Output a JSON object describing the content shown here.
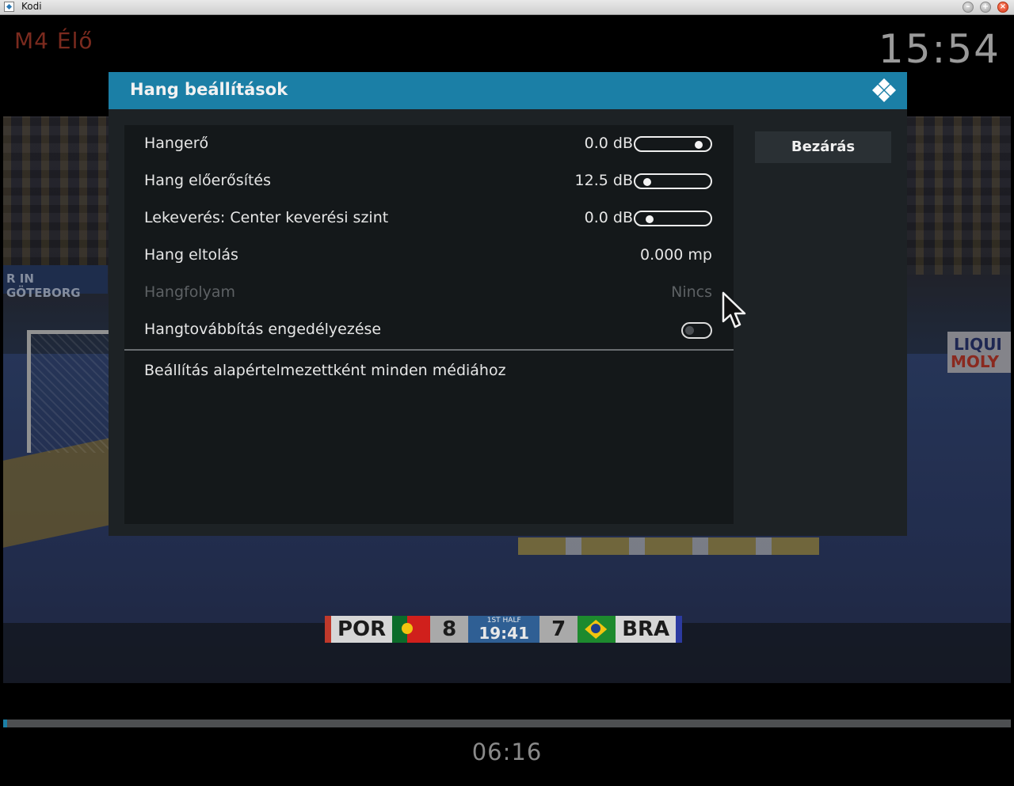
{
  "window": {
    "title": "Kodi",
    "app_icon": "kodi-app-icon",
    "controls": [
      "minimize",
      "maximize",
      "close"
    ]
  },
  "osd": {
    "channel": "M4 Élő",
    "clock": "15:54",
    "elapsed": "06:16",
    "progress_fraction": 0.004,
    "channel_color": "#7a2a1e"
  },
  "scoreboard": {
    "team_left": "POR",
    "score_left": "8",
    "period": "1ST HALF",
    "match_time": "19:41",
    "score_right": "7",
    "team_right": "BRA"
  },
  "video_text": {
    "left_banner": "R IN GÖTEBORG",
    "right_banner_1": "LIQUI",
    "right_banner_2": "MOLY"
  },
  "dialog": {
    "title": "Hang beállítások",
    "header_color": "#1b7fa6",
    "close_button": "Bezárás",
    "settings": [
      {
        "label": "Hangerő",
        "value": "0.0 dB",
        "control": "slider",
        "slider_fraction": 0.92
      },
      {
        "label": "Hang előerősítés",
        "value": "12.5 dB",
        "control": "slider",
        "slider_fraction": 0.08
      },
      {
        "label": "Lekeverés: Center keverési szint",
        "value": "0.0 dB",
        "control": "slider",
        "slider_fraction": 0.12
      },
      {
        "label": "Hang eltolás",
        "value": "0.000 mp",
        "control": "none"
      },
      {
        "label": "Hangfolyam",
        "value": "Nincs",
        "control": "none",
        "disabled": true
      },
      {
        "label": "Hangtovábbítás engedélyezése",
        "value": "",
        "control": "toggle",
        "toggle_on": false
      }
    ],
    "default_action": "Beállítás alapértelmezettként minden médiához"
  }
}
